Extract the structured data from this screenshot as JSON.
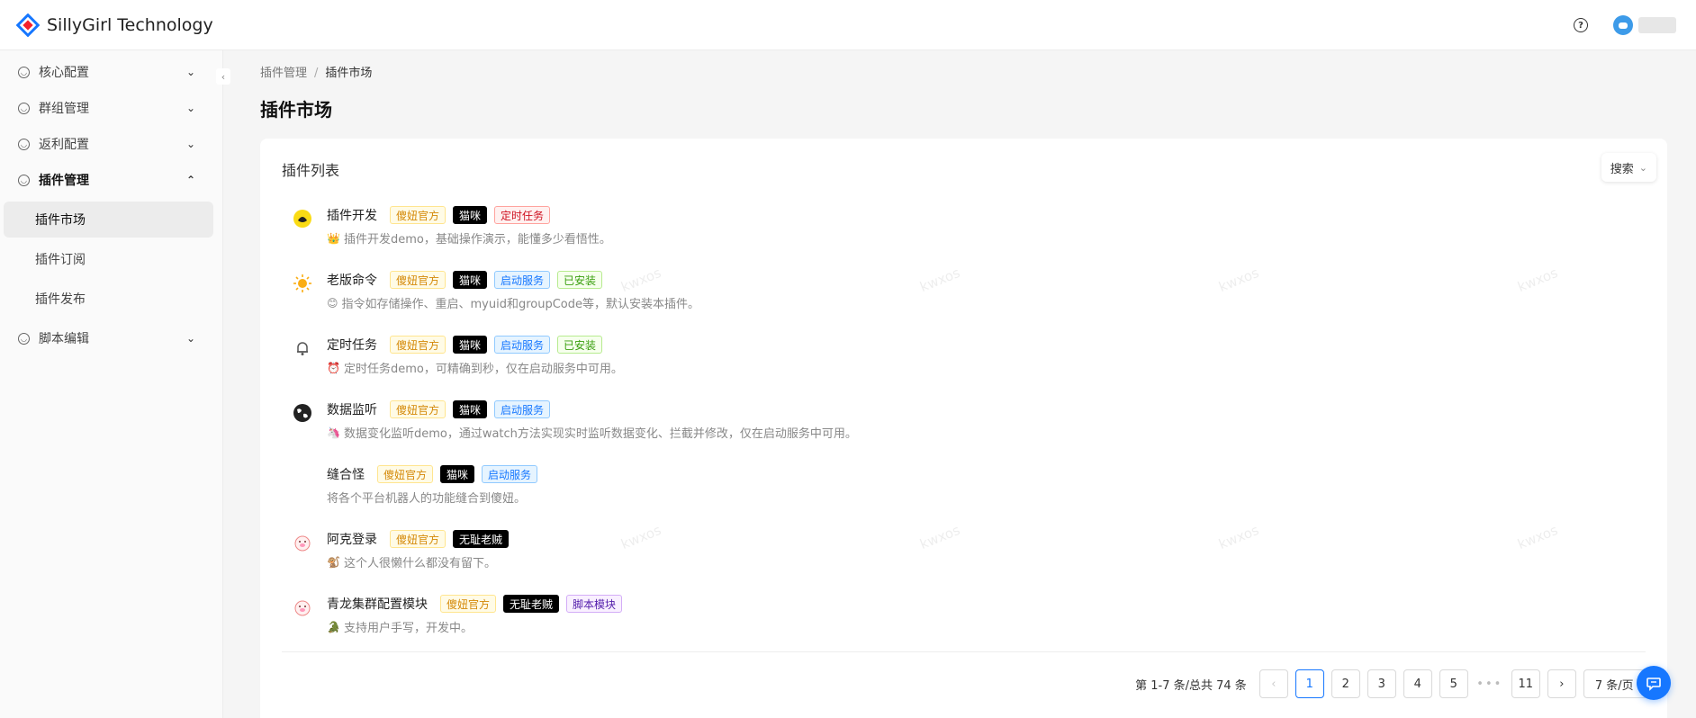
{
  "app": {
    "title": "SillyGirl Technology",
    "logo_icon": "diamond-logo",
    "brand_color": "#1677ff"
  },
  "header": {
    "help_icon": "question-circle-icon",
    "help_glyph": "?",
    "avatar_icon": "user-avatar"
  },
  "sidebar": {
    "collapse_glyph": "‹",
    "items": [
      {
        "label": "核心配置",
        "expanded": false
      },
      {
        "label": "群组管理",
        "expanded": false
      },
      {
        "label": "返利配置",
        "expanded": false
      },
      {
        "label": "插件管理",
        "expanded": true
      },
      {
        "label": "脚本编辑",
        "expanded": false
      }
    ],
    "sub_items": [
      {
        "label": "插件市场",
        "active": true
      },
      {
        "label": "插件订阅",
        "active": false
      },
      {
        "label": "插件发布",
        "active": false
      }
    ]
  },
  "breadcrumb": {
    "parent": "插件管理",
    "separator": "/",
    "current": "插件市场"
  },
  "page": {
    "title": "插件市场"
  },
  "card": {
    "title": "插件列表",
    "search_label": "搜索"
  },
  "plugins": [
    {
      "name": "插件开发",
      "icon": "duck-icon",
      "icon_glyph": "🐤",
      "tags": [
        {
          "label": "傻妞官方",
          "color": "orange"
        },
        {
          "label": "猫咪",
          "color": "black"
        },
        {
          "label": "定时任务",
          "color": "red"
        }
      ],
      "desc_emoji": "👑",
      "desc": "插件开发demo，基础操作演示，能懂多少看悟性。"
    },
    {
      "name": "老版命令",
      "icon": "sun-icon",
      "icon_glyph": "☀",
      "tags": [
        {
          "label": "傻妞官方",
          "color": "orange"
        },
        {
          "label": "猫咪",
          "color": "black"
        },
        {
          "label": "启动服务",
          "color": "blue"
        },
        {
          "label": "已安装",
          "color": "green"
        }
      ],
      "desc_emoji": "😊",
      "desc": "指令如存储操作、重启、myuid和groupCode等，默认安装本插件。"
    },
    {
      "name": "定时任务",
      "icon": "bell-icon",
      "icon_glyph": "🔔",
      "tags": [
        {
          "label": "傻妞官方",
          "color": "orange"
        },
        {
          "label": "猫咪",
          "color": "black"
        },
        {
          "label": "启动服务",
          "color": "blue"
        },
        {
          "label": "已安装",
          "color": "green"
        }
      ],
      "desc_emoji": "⏰",
      "desc": "定时任务demo，可精确到秒，仅在启动服务中可用。"
    },
    {
      "name": "数据监听",
      "icon": "globe-icon",
      "icon_glyph": "🌍",
      "tags": [
        {
          "label": "傻妞官方",
          "color": "orange"
        },
        {
          "label": "猫咪",
          "color": "black"
        },
        {
          "label": "启动服务",
          "color": "blue"
        }
      ],
      "desc_emoji": "🦄",
      "desc": "数据变化监听demo，通过watch方法实现实时监听数据变化、拦截并修改，仅在启动服务中可用。"
    },
    {
      "name": "缝合怪",
      "icon": "",
      "icon_glyph": "",
      "tags": [
        {
          "label": "傻妞官方",
          "color": "orange"
        },
        {
          "label": "猫咪",
          "color": "black"
        },
        {
          "label": "启动服务",
          "color": "blue"
        }
      ],
      "desc_emoji": "",
      "desc": "将各个平台机器人的功能缝合到傻妞。"
    },
    {
      "name": "阿克登录",
      "icon": "pig-icon",
      "icon_glyph": "🐷",
      "tags": [
        {
          "label": "傻妞官方",
          "color": "orange"
        },
        {
          "label": "无耻老贼",
          "color": "black"
        }
      ],
      "desc_emoji": "🐒",
      "desc": "这个人很懒什么都没有留下。"
    },
    {
      "name": "青龙集群配置模块",
      "icon": "pig-icon",
      "icon_glyph": "🐷",
      "tags": [
        {
          "label": "傻妞官方",
          "color": "orange"
        },
        {
          "label": "无耻老贼",
          "color": "black"
        },
        {
          "label": "脚本模块",
          "color": "purple"
        }
      ],
      "desc_emoji": "🐊",
      "desc": "支持用户手写，开发中。"
    }
  ],
  "pagination": {
    "total_text": "第 1-7 条/总共 74 条",
    "prev_glyph": "‹",
    "next_glyph": "›",
    "pages": [
      "1",
      "2",
      "3",
      "4",
      "5"
    ],
    "ellipsis": "•••",
    "last_page": "11",
    "current_page": "1",
    "page_size_label": "7 条/页"
  },
  "watermark": {
    "text": "kwxos"
  },
  "float_button": {
    "icon": "chat-bubble-icon"
  }
}
